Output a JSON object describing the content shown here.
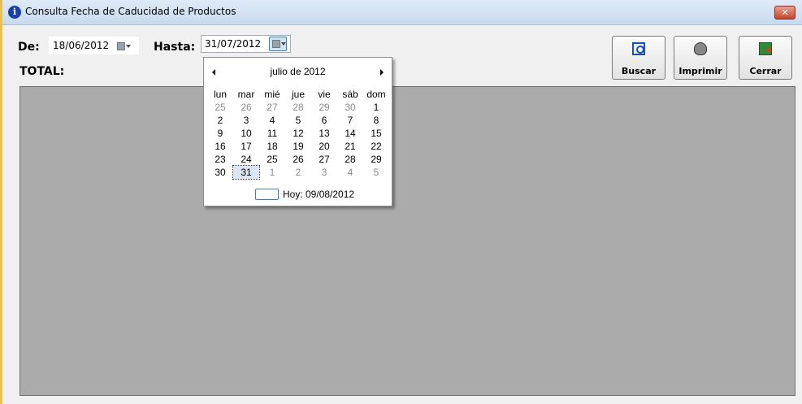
{
  "window": {
    "title": "Consulta Fecha de Caducidad de Productos"
  },
  "filters": {
    "de_label": "De:",
    "de_value": "18/06/2012",
    "hasta_label": "Hasta:",
    "hasta_value": "31/07/2012"
  },
  "total_label": "TOTAL:",
  "buttons": {
    "buscar": "Buscar",
    "imprimir": "Imprimir",
    "cerrar": "Cerrar"
  },
  "calendar": {
    "month_label": "julio de 2012",
    "weekdays": [
      "lun",
      "mar",
      "mié",
      "jue",
      "vie",
      "sáb",
      "dom"
    ],
    "weeks": [
      [
        [
          "25",
          1
        ],
        [
          "26",
          1
        ],
        [
          "27",
          1
        ],
        [
          "28",
          1
        ],
        [
          "29",
          1
        ],
        [
          "30",
          1
        ],
        [
          "1",
          0
        ]
      ],
      [
        [
          "2",
          0
        ],
        [
          "3",
          0
        ],
        [
          "4",
          0
        ],
        [
          "5",
          0
        ],
        [
          "6",
          0
        ],
        [
          "7",
          0
        ],
        [
          "8",
          0
        ]
      ],
      [
        [
          "9",
          0
        ],
        [
          "10",
          0
        ],
        [
          "11",
          0
        ],
        [
          "12",
          0
        ],
        [
          "13",
          0
        ],
        [
          "14",
          0
        ],
        [
          "15",
          0
        ]
      ],
      [
        [
          "16",
          0
        ],
        [
          "17",
          0
        ],
        [
          "18",
          0
        ],
        [
          "19",
          0
        ],
        [
          "20",
          0
        ],
        [
          "21",
          0
        ],
        [
          "22",
          0
        ]
      ],
      [
        [
          "23",
          0
        ],
        [
          "24",
          0
        ],
        [
          "25",
          0
        ],
        [
          "26",
          0
        ],
        [
          "27",
          0
        ],
        [
          "28",
          0
        ],
        [
          "29",
          0
        ]
      ],
      [
        [
          "30",
          0
        ],
        [
          "31",
          2
        ],
        [
          "1",
          1
        ],
        [
          "2",
          1
        ],
        [
          "3",
          1
        ],
        [
          "4",
          1
        ],
        [
          "5",
          1
        ]
      ]
    ],
    "today_label": "Hoy: 09/08/2012"
  }
}
